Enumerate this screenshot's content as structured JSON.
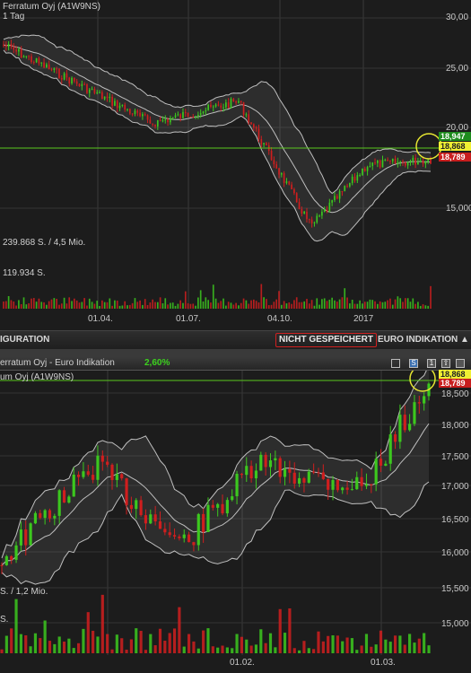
{
  "top_chart": {
    "title": "Ferratum Oyj (A1W9NS)",
    "interval": "1 Tag",
    "volume_label_1": "239.868 S. / 4,5 Mio.",
    "volume_label_2": "119.934 S.",
    "x_ticks": [
      "01.04.",
      "01.07.",
      "04.10.",
      "2017"
    ],
    "y_ticks": [
      "30,00",
      "25,00",
      "20,00",
      "15,000"
    ],
    "price_tags": [
      "18,947",
      "18,868",
      "18,789"
    ]
  },
  "toolbar": {
    "left_label": "IGURATION",
    "not_saved": "NICHT GESPEICHERT",
    "indication": "EURO INDIKATION",
    "indication_arrow": "▲"
  },
  "bottom_chart": {
    "title": "erratum Oyj - Euro Indikation",
    "change": "2,60%",
    "subtitle": "um Oyj (A1W9NS)",
    "volume_label": "S. / 1,2 Mio.",
    "volume_label_2": "S.",
    "x_ticks": [
      "01.02.",
      "01.03."
    ],
    "y_ticks": [
      "18,500",
      "18,000",
      "17,500",
      "17,000",
      "16,500",
      "16,000",
      "15,500",
      "15,000"
    ],
    "price_tags": [
      "18,868",
      "18,789"
    ],
    "window_buttons": [
      "S",
      "1",
      "⇧"
    ]
  },
  "colors": {
    "up": "#3cc81e",
    "down": "#d01e1e",
    "band": "#bfbfbf",
    "hline": "#5ac81e",
    "highlight_circle": "#e6e632",
    "tag_green": "#1e8c1e",
    "tag_yellow": "#f0f032",
    "tag_red": "#c81e1e"
  }
}
